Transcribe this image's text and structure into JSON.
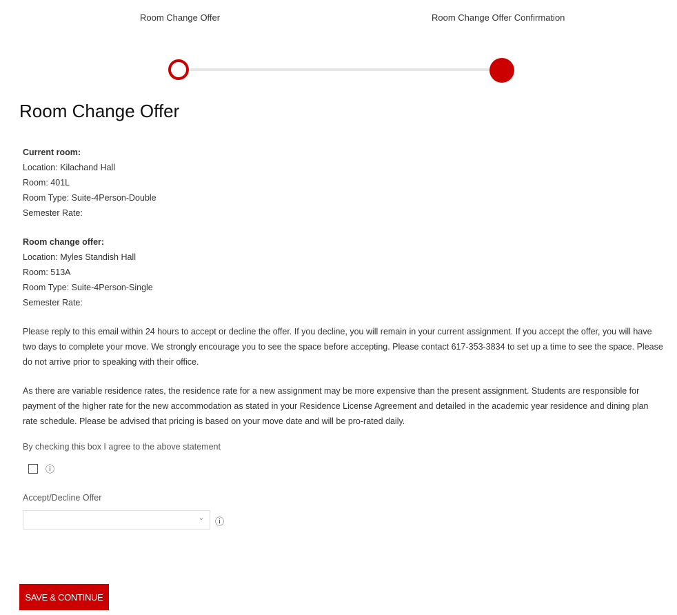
{
  "stepper": {
    "steps": [
      "Room Change Offer",
      "Room Change Offer Confirmation"
    ]
  },
  "title": "Room Change Offer",
  "current": {
    "heading": "Current room:",
    "location": "Location: Kilachand Hall",
    "room": "Room: 401L",
    "type": "Room Type: Suite-4Person-Double",
    "rate": "Semester Rate:"
  },
  "offer": {
    "heading": "Room change offer:",
    "location": "Location: Myles Standish Hall",
    "room": "Room: 513A",
    "type": "Room Type: Suite-4Person-Single",
    "rate": "Semester Rate:"
  },
  "paragraphs": [
    "Please reply to this email within 24 hours to accept or decline the offer. If you decline, you will remain in your current assignment. If you accept the offer, you will have two days to complete your move. We strongly encourage you to see the space before accepting. Please contact 617-353-3834 to set up a time to see the space. Please do not arrive prior to speaking with their office.",
    "As there are variable residence rates, the residence rate for a new assignment may be more expensive than the present assignment. Students are responsible for payment of the higher rate for the new accommodation as stated in your Residence License Agreement and detailed in the academic year residence and dining plan rate schedule. Please be advised that pricing is based on your move date and will be pro-rated daily."
  ],
  "agree_label": "By checking this box I agree to the above statement",
  "select_label": "Accept/Decline Offer",
  "select_value": "",
  "info_glyph": "ⓘ",
  "chevron": "⌄",
  "save_label": "SAVE & CONTINUE",
  "accent": "#cc0000"
}
